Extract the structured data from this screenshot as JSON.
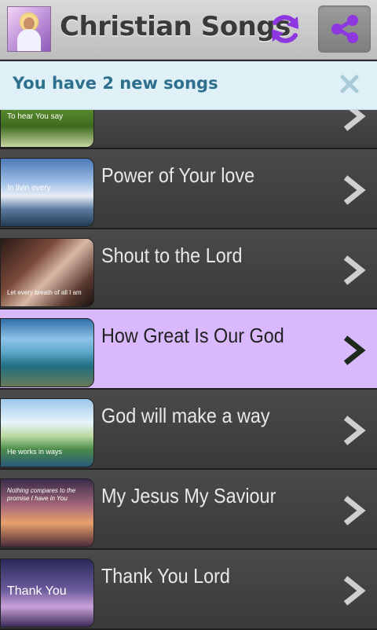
{
  "app": {
    "title": "Christian Songs"
  },
  "notice": {
    "text": "You have 2 new songs"
  },
  "songs": [
    {
      "title": "",
      "thumb_caption": "To hear You say",
      "state": "partial"
    },
    {
      "title": "Power of Your love",
      "thumb_caption": "In livin every",
      "state": "normal"
    },
    {
      "title": "Shout to the Lord",
      "thumb_caption": "Let every breath of all I am",
      "state": "normal"
    },
    {
      "title": "How Great Is Our God",
      "thumb_caption": "",
      "state": "selected"
    },
    {
      "title": "God will make a way",
      "thumb_caption": "He works in ways",
      "state": "normal"
    },
    {
      "title": "My Jesus My Saviour",
      "thumb_caption": "Nothing compares to the promise I have in You",
      "state": "normal"
    },
    {
      "title": "Thank You Lord",
      "thumb_caption": "Thank You",
      "state": "normal"
    }
  ],
  "colors": {
    "selected_row": "#d9b9fb",
    "accent": "#8e36e0",
    "notice_bg": "#dff1f7",
    "notice_text": "#2e6f8e"
  },
  "icons": {
    "refresh": "refresh-icon",
    "share": "share-icon",
    "close": "close-icon",
    "chevron": "chevron-right-icon"
  }
}
